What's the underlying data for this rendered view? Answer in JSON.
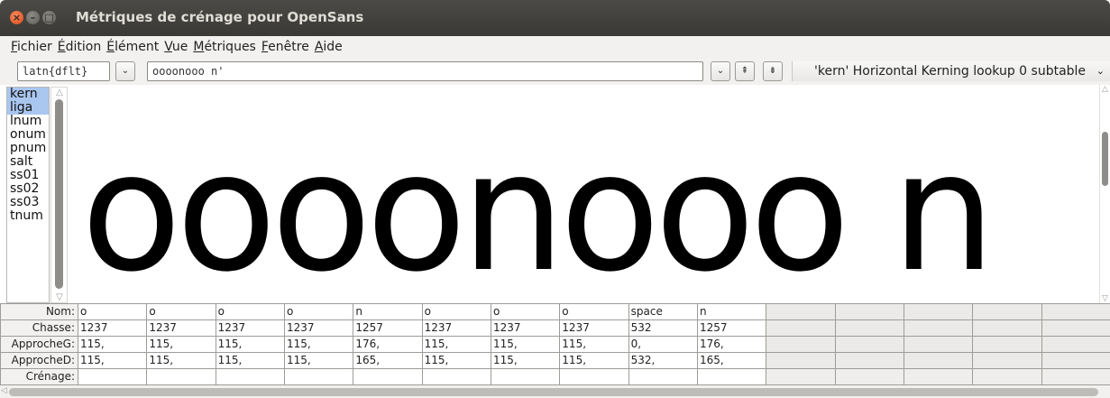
{
  "window": {
    "title": "Métriques de crénage pour OpenSans",
    "close_glyph": "×",
    "min_glyph": "–",
    "max_glyph": "□"
  },
  "menu": [
    {
      "accel": "F",
      "rest": "ichier"
    },
    {
      "accel": "É",
      "rest": "dition"
    },
    {
      "accel": "É",
      "rest": "lément"
    },
    {
      "accel": "V",
      "rest": "ue"
    },
    {
      "accel": "M",
      "rest": "étriques"
    },
    {
      "accel": "F",
      "rest": "enêtre"
    },
    {
      "accel": "A",
      "rest": "ide"
    }
  ],
  "toolbar": {
    "script_value": "latn{dflt}",
    "script_chevron": "⌄",
    "text_value": "oooonooo n'",
    "text_chevron": "⌄",
    "size_up_glyph": "⇞",
    "size_down_glyph": "⇟",
    "lookup_value": "'kern' Horizontal Kerning lookup 0 subtable",
    "lookup_chevron": "⌄"
  },
  "features": [
    "kern",
    "liga",
    "lnum",
    "onum",
    "pnum",
    "salt",
    "ss01",
    "ss02",
    "ss03",
    "tnum"
  ],
  "selected_features": [
    "kern",
    "liga"
  ],
  "preview_text": "oooonooo n",
  "metrics": {
    "labels": {
      "name": "Nom:",
      "advance": "Chasse:",
      "lbearing": "ApprocheG:",
      "rbearing": "ApprocheD:",
      "kern": "Crénage:"
    },
    "columns": [
      {
        "name": "o",
        "advance": "1237",
        "lbearing": "115,",
        "rbearing": "115,"
      },
      {
        "name": "o",
        "advance": "1237",
        "lbearing": "115,",
        "rbearing": "115,"
      },
      {
        "name": "o",
        "advance": "1237",
        "lbearing": "115,",
        "rbearing": "115,"
      },
      {
        "name": "o",
        "advance": "1237",
        "lbearing": "115,",
        "rbearing": "115,"
      },
      {
        "name": "n",
        "advance": "1257",
        "lbearing": "176,",
        "rbearing": "165,"
      },
      {
        "name": "o",
        "advance": "1237",
        "lbearing": "115,",
        "rbearing": "115,"
      },
      {
        "name": "o",
        "advance": "1237",
        "lbearing": "115,",
        "rbearing": "115,"
      },
      {
        "name": "o",
        "advance": "1237",
        "lbearing": "115,",
        "rbearing": "115,"
      },
      {
        "name": "space",
        "advance": "532",
        "lbearing": "0,",
        "rbearing": "532,"
      },
      {
        "name": "n",
        "advance": "1257",
        "lbearing": "176,",
        "rbearing": "165,"
      }
    ],
    "empty_columns": 5
  },
  "colors": {
    "titlebar": "#3d3c38",
    "close_button": "#e0531f",
    "selection": "#a9c6ef"
  }
}
